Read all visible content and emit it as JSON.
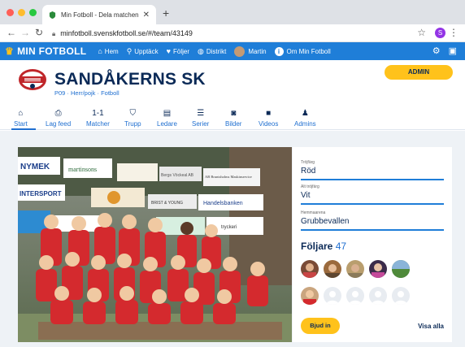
{
  "browser": {
    "tab_title": "Min Fotboll - Dela matchen - de",
    "url": "minfotboll.svenskfotboll.se/#/team/43149",
    "profile_initial": "S"
  },
  "topnav": {
    "brand": "MIN FOTBOLL",
    "items": [
      {
        "label": "Hem",
        "icon": "home-icon"
      },
      {
        "label": "Upptäck",
        "icon": "search-icon"
      },
      {
        "label": "Följer",
        "icon": "heart-icon"
      },
      {
        "label": "Distrikt",
        "icon": "globe-icon"
      },
      {
        "label": "Martin",
        "icon": "avatar"
      },
      {
        "label": "Om Min Fotboll",
        "icon": "info-icon"
      }
    ]
  },
  "club": {
    "name": "SANDÅKERNS SK",
    "subtitle": "P09 · Herr/pojk · Fotboll",
    "admin_label": "ADMIN"
  },
  "tabs": [
    {
      "label": "Start",
      "icon": "home-icon"
    },
    {
      "label": "Lag feed",
      "icon": "feed-icon"
    },
    {
      "label": "Matcher",
      "icon": "match-icon"
    },
    {
      "label": "Trupp",
      "icon": "shirt-icon"
    },
    {
      "label": "Ledare",
      "icon": "clipboard-icon"
    },
    {
      "label": "Serier",
      "icon": "list-icon"
    },
    {
      "label": "Bilder",
      "icon": "camera-icon"
    },
    {
      "label": "Videos",
      "icon": "video-icon"
    },
    {
      "label": "Admins",
      "icon": "person-icon"
    }
  ],
  "info": {
    "shirt_label": "Tröjfärg",
    "shirt_value": "Röd",
    "alt_shirt_label": "Alt tröjfärg",
    "alt_shirt_value": "Vit",
    "home_label": "Hemmaarena",
    "home_value": "Grubbevallen",
    "followers_label": "Följare",
    "followers_count": "47",
    "invite_label": "Bjud in",
    "show_all_label": "Visa alla"
  },
  "photo_banners": {
    "nymek": "NYMEK",
    "martinsons": "martinsons",
    "intersport": "INTERSPORT",
    "handelsbanken": "Handelsbanken",
    "tryckeri": "tryckeri",
    "bergs_vorkeal": "Bergs Vöckeal AB",
    "bruntsholms": "AB Bruntsholms Maskinservice",
    "brist": "BRIST & YOUNG"
  },
  "colors": {
    "brand_blue": "#1f7ed8",
    "accent_yellow": "#ffc21b",
    "navy": "#0b2a57",
    "jersey_red": "#d42a2e"
  }
}
